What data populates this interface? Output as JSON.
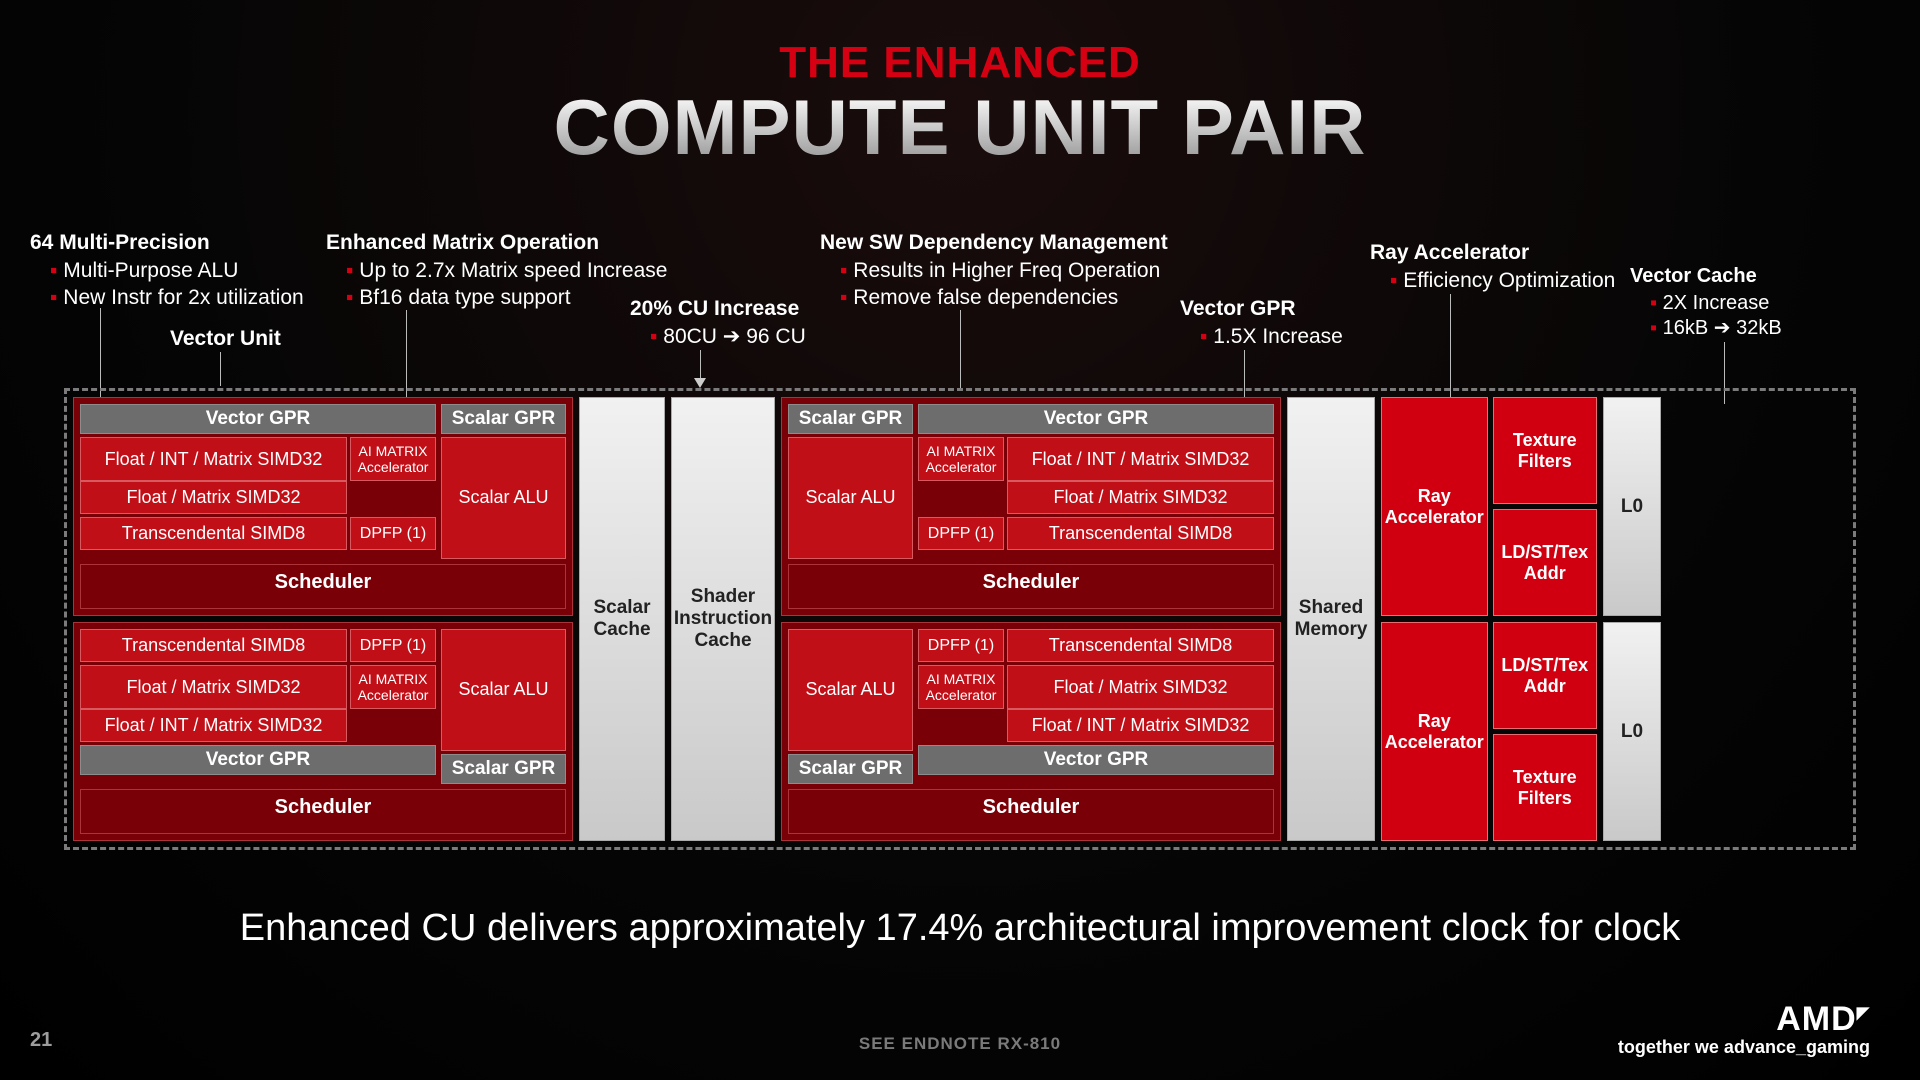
{
  "title": {
    "small": "THE ENHANCED",
    "big": "COMPUTE UNIT PAIR"
  },
  "annotations": {
    "multiprec": {
      "heading": "64 Multi-Precision",
      "items": [
        "Multi-Purpose ALU",
        "New Instr for 2x utilization"
      ]
    },
    "vector_unit": {
      "heading": "Vector Unit"
    },
    "matrix": {
      "heading": "Enhanced Matrix Operation",
      "items": [
        "Up to 2.7x Matrix speed Increase",
        "Bf16 data type support"
      ]
    },
    "cu_increase": {
      "heading": "20% CU Increase",
      "items": [
        "80CU ➔ 96 CU"
      ]
    },
    "swdep": {
      "heading": "New SW Dependency Management",
      "items": [
        "Results in Higher Freq Operation",
        "Remove false dependencies"
      ]
    },
    "vgpr": {
      "heading": "Vector GPR",
      "items": [
        "1.5X Increase"
      ]
    },
    "ray": {
      "heading": "Ray Accelerator",
      "items": [
        "Efficiency Optimization"
      ]
    },
    "vcache": {
      "heading": "Vector Cache",
      "items": [
        "2X Increase",
        "16kB ➔ 32kB"
      ]
    }
  },
  "diagram": {
    "scheduler": "Scheduler",
    "vector_gpr": "Vector GPR",
    "scalar_gpr": "Scalar GPR",
    "scalar_alu": "Scalar ALU",
    "rows": {
      "fi_simd32": "Float / INT / Matrix SIMD32",
      "fm_simd32": "Float / Matrix SIMD32",
      "trans_simd8": "Transcendental SIMD8",
      "ai_matrix": "AI MATRIX Accelerator",
      "dpfp": "DPFP (1)"
    },
    "scalar_cache": "Scalar Cache",
    "shader_icache": "Shader Instruction Cache",
    "shared_memory": "Shared Memory",
    "ray_accel": "Ray Accelerator",
    "tex_filters": "Texture Filters",
    "ldst": "LD/ST/Tex Addr",
    "l0": "L0"
  },
  "claim": "Enhanced CU delivers approximately 17.4% architectural improvement clock for clock",
  "page_number": "21",
  "endnote": "SEE ENDNOTE RX-810",
  "brand": {
    "name": "AMD",
    "tagline": "together we advance_gaming"
  }
}
